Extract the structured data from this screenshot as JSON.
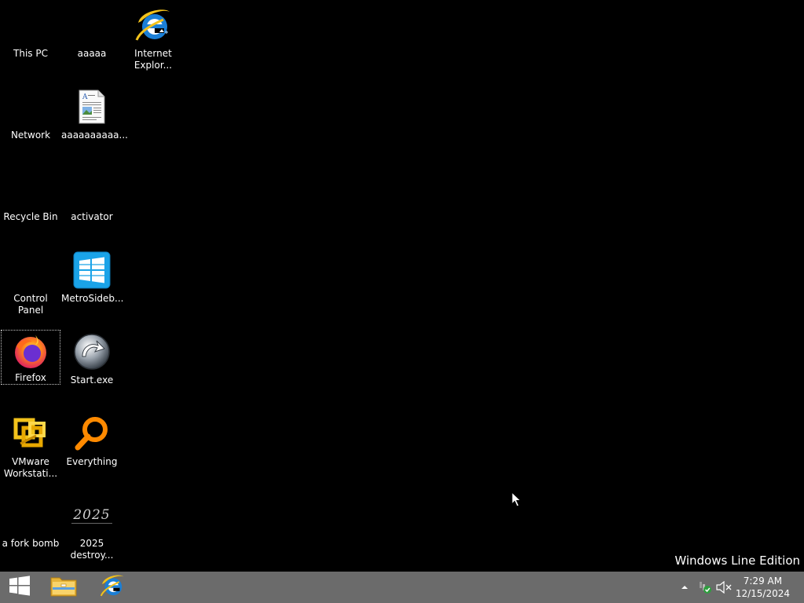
{
  "desktop": {
    "icons": [
      {
        "label": "This PC",
        "icon": "this-pc-icon"
      },
      {
        "label": "aaaaa",
        "icon": "blank-icon"
      },
      {
        "label": "Internet\nExplor...",
        "icon": "internet-explorer-icon"
      },
      {
        "label": "Network",
        "icon": "network-icon"
      },
      {
        "label": "aaaaaaaaaa...",
        "icon": "document-icon"
      },
      {
        "label": "Recycle Bin",
        "icon": "recycle-bin-icon"
      },
      {
        "label": "activator",
        "icon": "blank-icon"
      },
      {
        "label": "Control Panel",
        "icon": "control-panel-icon"
      },
      {
        "label": "MetroSideb...",
        "icon": "metro-sidebar-icon"
      },
      {
        "label": "Firefox",
        "icon": "firefox-icon"
      },
      {
        "label": "Start.exe",
        "icon": "start-exe-icon"
      },
      {
        "label": "VMware\nWorkstati...",
        "icon": "vmware-icon"
      },
      {
        "label": "Everything",
        "icon": "everything-search-icon"
      },
      {
        "label": "a fork bomb",
        "icon": "blank-icon"
      },
      {
        "label": "2025\ndestroy...",
        "icon": "2025-image-icon"
      }
    ],
    "selected_icon": "Firefox",
    "watermark": "Windows Line Edition",
    "image_2025_text": "2025"
  },
  "taskbar": {
    "start_icon": "windows-logo-icon",
    "pinned": [
      {
        "name": "File Explorer",
        "icon": "file-explorer-icon"
      },
      {
        "name": "Internet Explorer",
        "icon": "internet-explorer-icon"
      }
    ],
    "tray": {
      "show_hidden_icon": "chevron-up-icon",
      "network_icon": "network-status-icon",
      "volume_icon": "volume-muted-icon"
    },
    "clock": {
      "time": "7:29 AM",
      "date": "12/15/2024"
    }
  },
  "colors": {
    "desktop_bg": "#000000",
    "taskbar_bg": "#6b6b6b",
    "text": "#ffffff"
  }
}
